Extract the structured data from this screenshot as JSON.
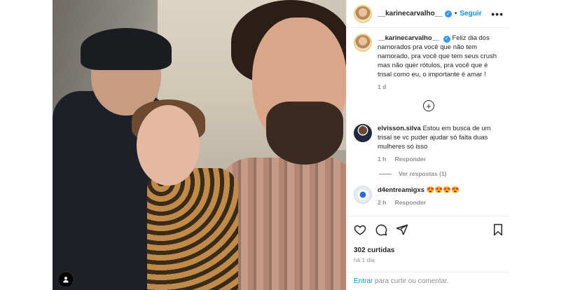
{
  "post": {
    "author": "__karinecarvalho__",
    "follow_label": "Seguir",
    "more_label": "•••",
    "caption": "Feliz dia dos namorados pra você que não tem namorado, pra você que tem seus crush mas não quer rótulos, pra você que é trisal como eu, o importante é amar !",
    "caption_age": "1 d",
    "likes": "302 curtidas",
    "posted": "há 1 dia",
    "add_comment_enter": "Entrar",
    "add_comment_rest": " para curtir ou comentar."
  },
  "comments": [
    {
      "user": "elvisson.silva",
      "text": "Estou em busca de um trisal se vc puder ajudar só falta duas mulheres só isso",
      "age": "1 h",
      "reply": "Responder",
      "view_replies": "Ver respostas (1)"
    },
    {
      "user": "d4entreamigxs",
      "text": "😍😍😍😍",
      "age": "2 h",
      "reply": "Responder"
    }
  ],
  "colors": {
    "link": "#0095f6",
    "verified": "#3897f0",
    "muted": "#8e8e8e"
  },
  "icons": [
    "more-icon",
    "verified-icon",
    "add-comment-icon",
    "heart-icon",
    "comment-icon",
    "share-icon",
    "bookmark-icon",
    "user-tag-icon"
  ]
}
